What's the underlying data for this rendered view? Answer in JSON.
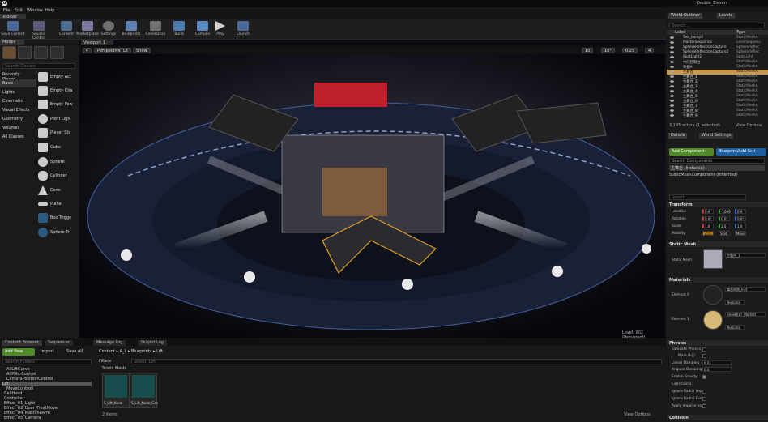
{
  "title": {
    "project": "Double_Eleven"
  },
  "menu": [
    "File",
    "Edit",
    "Window",
    "Help"
  ],
  "toolbar_tab": "Toolbar",
  "toolbar": [
    {
      "label": "Save Current",
      "color": "#4a6a9a"
    },
    {
      "label": "Source Control",
      "color": "#5a5a7a"
    },
    {
      "label": "Content",
      "color": "#4f6f8f"
    },
    {
      "label": "Marketplace",
      "color": "#7a7aa0"
    },
    {
      "label": "Settings",
      "color": "#707070"
    },
    {
      "label": "Blueprints",
      "color": "#6080b0"
    },
    {
      "label": "Cinematics",
      "color": "#707070"
    },
    {
      "label": "Build",
      "color": "#4a7ab0"
    },
    {
      "label": "Compile",
      "color": "#5a8ac0"
    },
    {
      "label": "Play",
      "color": "#d0d0d0"
    },
    {
      "label": "Launch",
      "color": "#4a6a9a"
    }
  ],
  "modes": {
    "tab": "Modes",
    "search": "Search Classes",
    "categories": [
      "Recently Placed",
      "Basic",
      "Lights",
      "Cinematic",
      "Visual Effects",
      "Geometry",
      "Volumes",
      "All Classes"
    ],
    "selected": "Basic",
    "placeables": [
      "Empty Act",
      "Empty Cha",
      "Empty Paw",
      "Point Ligh",
      "Player Sta",
      "Cube",
      "Sphere",
      "Cylinder",
      "Cone",
      "Plane",
      "Box Trigge",
      "Sphere Tr"
    ]
  },
  "viewport": {
    "tab": "Viewport 1",
    "perspective": "Perspective",
    "lit": "Lit",
    "show": "Show",
    "snap1": "10",
    "snap2": "10°",
    "snap3": "0.25",
    "cam": "4",
    "level": "Level:  Wl2 (Persistent)"
  },
  "content_browser": {
    "tabs": [
      "Content Browser",
      "Sequencer",
      "Message Log",
      "Output Log"
    ],
    "add_new": "Add New",
    "import": "Import",
    "save_all": "Save All",
    "path": [
      "Content",
      "A_L",
      "Blueprints",
      "Lift"
    ],
    "search_folders": "Search Folders",
    "filters": "Filters",
    "search_assets": "Search Lift",
    "category": "Static Mesh",
    "tree": [
      "AllLiftCurve",
      "AllPillarControl",
      "CameraPositionControl",
      "Lift",
      "MoveControll",
      "CellHead",
      "Controller",
      "Effect_01_Light",
      "Effect_02_Door_FloatMove",
      "Effect_04_MachineArm",
      "Effect_05_Camera"
    ],
    "assets": [
      "S_Lift_Node",
      "S_Lift_Node_Gen"
    ],
    "item_count": "2 items",
    "view_options": "View Options"
  },
  "outliner": {
    "tabs": [
      "World Outliner",
      "Levels"
    ],
    "search": "Search...",
    "col_label": "Label",
    "col_type": "Type",
    "rows": [
      {
        "label": "Sea_Lamp3",
        "type": "StaticMeshA"
      },
      {
        "label": "MasterSequence",
        "type": "LevelSequenc"
      },
      {
        "label": "SphereReflectionCapture",
        "type": "SphereReflec"
      },
      {
        "label": "SphereReflectionCapture2",
        "type": "SphereReflec"
      },
      {
        "label": "SpotLight2",
        "type": "SpotLight"
      },
      {
        "label": "中间控制台",
        "type": "StaticMeshA"
      },
      {
        "label": "天棚A",
        "type": "StaticMeshA"
      },
      {
        "label": "主舞台",
        "type": "StaticMeshA"
      },
      {
        "label": "主舞台_1",
        "type": "StaticMeshA"
      },
      {
        "label": "主舞台_2",
        "type": "StaticMeshA"
      },
      {
        "label": "主舞台_3",
        "type": "StaticMeshA"
      },
      {
        "label": "主舞台_4",
        "type": "StaticMeshA"
      },
      {
        "label": "主舞台_5",
        "type": "StaticMeshA"
      },
      {
        "label": "主舞台_6",
        "type": "StaticMeshA"
      },
      {
        "label": "主舞台_7",
        "type": "StaticMeshA"
      },
      {
        "label": "主舞台_8",
        "type": "StaticMeshA"
      },
      {
        "label": "主舞台_9",
        "type": "StaticMeshA"
      }
    ],
    "selected_index": 7,
    "footer": "3,195 actors (1 selected)",
    "view_options": "View Options"
  },
  "details": {
    "tabs": [
      "Details",
      "World Settings"
    ],
    "add_component": "Add Component",
    "blueprint_add": "Blueprint/Add Scri",
    "search_components": "Search Components",
    "selected_component": "主舞台 (Instance)",
    "static_mesh_component": "StaticMeshComponent (Inherited)",
    "search_details": "Search",
    "transform": "Transform",
    "location": {
      "label": "Location",
      "x": "0.0",
      "y": "-1000",
      "z": "0.0"
    },
    "rotation": {
      "label": "Rotation",
      "x": "0.0°",
      "y": "0.0°",
      "z": "0.0°"
    },
    "scale": {
      "label": "Scale",
      "x": "1.0",
      "y": "1.0",
      "z": "1.0"
    },
    "mobility": {
      "label": "Mobility",
      "options": [
        "Static",
        "Stati",
        "Move"
      ]
    },
    "static_mesh_sec": "Static Mesh",
    "static_mesh": {
      "label": "Static Mesh",
      "value": "主舞台_1"
    },
    "materials_sec": "Materials",
    "element0": {
      "label": "Element 0",
      "value": "舞台材质_Inst",
      "textures": "Textures"
    },
    "element1": {
      "label": "Element 1",
      "value": "Sheet017_MatInst",
      "textures": "Textures"
    },
    "physics_sec": "Physics",
    "physics": [
      {
        "label": "Simulate Physics"
      },
      {
        "label": "Mass (kg)"
      },
      {
        "label": "Linear Damping",
        "value": "0.01"
      },
      {
        "label": "Angular Damping",
        "value": "0.0"
      },
      {
        "label": "Enable Gravity"
      },
      {
        "label": "Constraints"
      },
      {
        "label": "Ignore Radial Impu"
      },
      {
        "label": "Ignore Radial Force"
      },
      {
        "label": "Apply Impulse on D"
      }
    ],
    "collision_sec": "Collision"
  }
}
